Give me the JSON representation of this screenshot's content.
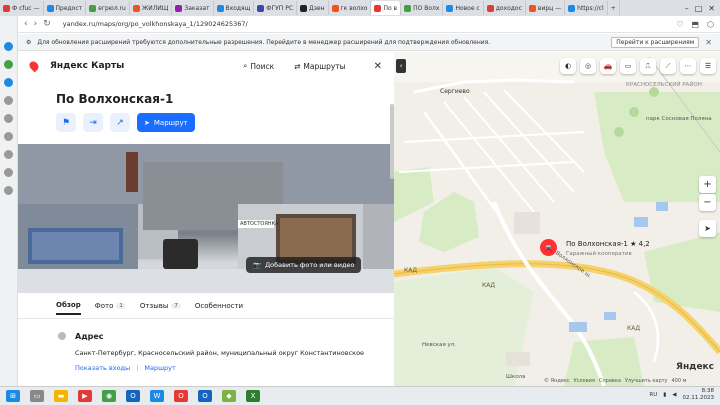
{
  "browser": {
    "tabs": [
      {
        "label": "Ф  cfuc —",
        "color": "#e53935"
      },
      {
        "label": "Предост",
        "color": "#1e88e5"
      },
      {
        "label": "егрюл.ru",
        "color": "#43a047"
      },
      {
        "label": "ЖИЛИЩ",
        "color": "#f4511e"
      },
      {
        "label": "Заказат",
        "color": "#8e24aa"
      },
      {
        "label": "Входящ",
        "color": "#1e88e5"
      },
      {
        "label": "ФГУП РС",
        "color": "#3949ab"
      },
      {
        "label": "Дзен",
        "color": "#222222"
      },
      {
        "label": "гк волхо",
        "color": "#f4511e"
      },
      {
        "label": "По в",
        "color": "#e53935",
        "active": true
      },
      {
        "label": "ПО Волх",
        "color": "#43a047"
      },
      {
        "label": "Новое с",
        "color": "#1e88e5"
      },
      {
        "label": "доходос",
        "color": "#e53935"
      },
      {
        "label": "вирц —",
        "color": "#f4511e"
      },
      {
        "label": "https://cl",
        "color": "#1e88e5"
      }
    ],
    "new_tab": "+",
    "url": "yandex.ru/maps/org/po_volkhonskaya_1/129024625367/",
    "notification": {
      "text": "Для обновления расширений требуются дополнительные разрешения. Перейдите в менеджер расширений для подтверждения обновления.",
      "button": "Перейти к расширениям"
    }
  },
  "panel": {
    "brand": "Яндекс Карты",
    "search_label": "Поиск",
    "routes_label": "Маршруты",
    "title": "По Волхонская-1",
    "route_button": "Маршрут",
    "add_photo": "Добавить фото или видео",
    "tabs": [
      {
        "label": "Обзор",
        "count": ""
      },
      {
        "label": "Фото",
        "count": "1"
      },
      {
        "label": "Отзывы",
        "count": "7"
      },
      {
        "label": "Особенности",
        "count": ""
      }
    ],
    "address_label": "Адрес",
    "address": "Санкт-Петербург, Красносельский район, муниципальный округ Константиновское",
    "show_entrances": "Показать входы",
    "route_link": "Маршрут",
    "photo_sign": "АВТОСТОЯНКА"
  },
  "map": {
    "poi_name": "По Волхонская-1 ★ 4,2",
    "poi_sub": "Гаражный кооператив",
    "labels": {
      "district": "КРАСНОСЕЛЬСКИЙ РАЙОН",
      "park": "парк Сосновая Поляна",
      "sergievo": "Сергиево",
      "kad1": "КАД",
      "kad2": "КАД",
      "kad3": "КАД",
      "volkhonskoe": "Волхонское ш.",
      "school": "Школа",
      "nevskaya": "Невская ул."
    },
    "footer": [
      "© Яндекс",
      "Условия",
      "Справка",
      "Улучшить карту",
      "400 м"
    ],
    "logo": "Яндекс"
  },
  "taskbar": {
    "lang": "RU",
    "time": "8:38",
    "date": "02.11.2023"
  }
}
